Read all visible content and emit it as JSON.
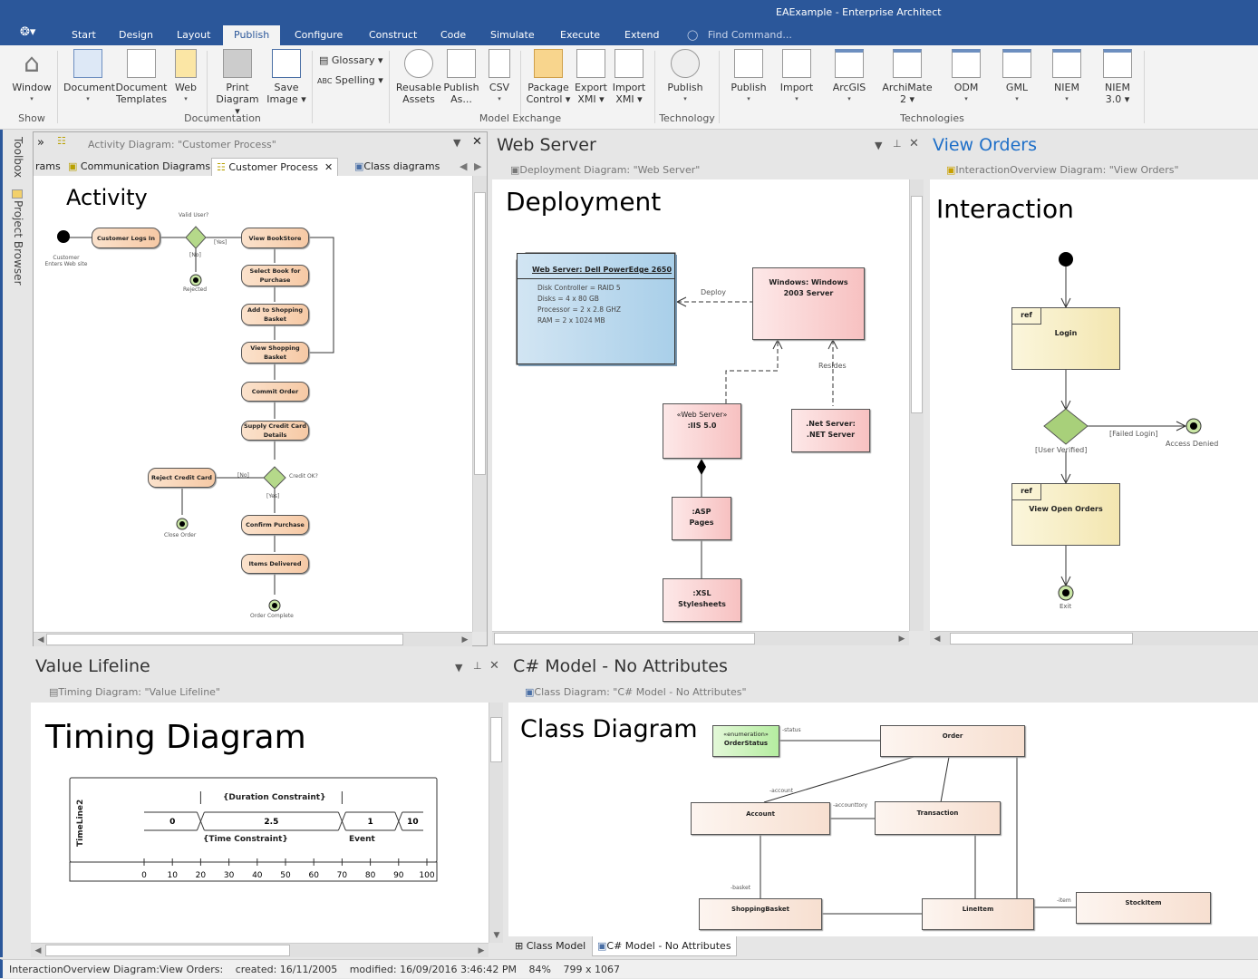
{
  "window": {
    "title": "EAExample - Enterprise Architect"
  },
  "menu": {
    "tabs": [
      "Start",
      "Design",
      "Layout",
      "Publish",
      "Configure",
      "Construct",
      "Code",
      "Simulate",
      "Execute",
      "Extend"
    ],
    "active": "Publish",
    "find_placeholder": "Find Command..."
  },
  "ribbon": {
    "buttons": [
      {
        "label": "Window",
        "sub": "▾"
      },
      {
        "label": "Document",
        "sub": "▾"
      },
      {
        "label": "Document",
        "sub": "Templates"
      },
      {
        "label": "Web",
        "sub": "▾"
      },
      {
        "label": "Print",
        "sub": "Diagram ▾"
      },
      {
        "label": "Save",
        "sub": "Image ▾"
      },
      {
        "label": "Reusable",
        "sub": "Assets"
      },
      {
        "label": "Publish",
        "sub": "As..."
      },
      {
        "label": "CSV",
        "sub": "▾"
      },
      {
        "label": "Package",
        "sub": "Control ▾"
      },
      {
        "label": "Export",
        "sub": "XMI ▾"
      },
      {
        "label": "Import",
        "sub": "XMI ▾"
      },
      {
        "label": "Publish",
        "sub": "▾"
      },
      {
        "label": "Publish",
        "sub": "▾"
      },
      {
        "label": "Import",
        "sub": "▾"
      },
      {
        "label": "ArcGIS",
        "sub": "▾"
      },
      {
        "label": "ArchiMate",
        "sub": "2 ▾"
      },
      {
        "label": "ODM",
        "sub": "▾"
      },
      {
        "label": "GML",
        "sub": "▾"
      },
      {
        "label": "NIEM",
        "sub": "▾"
      },
      {
        "label": "NIEM",
        "sub": "3.0 ▾"
      }
    ],
    "small": {
      "glossary": "Glossary ▾",
      "spelling": "Spelling ▾"
    },
    "groups": [
      "Show",
      "Documentation",
      "Model Exchange",
      "Technology",
      "Technologies"
    ]
  },
  "side": {
    "toolbox": "Toolbox",
    "project_browser": "Project Browser"
  },
  "activity_panel": {
    "header": "Activity Diagram: \"Customer Process\"",
    "tabs": [
      "rams",
      "Communication Diagrams",
      "Customer Process",
      "Class diagrams"
    ],
    "active_tab": "Customer Process",
    "heading": "Activity",
    "nodes": [
      "Customer Logs In",
      "View BookStore",
      "Select Book for Purchase",
      "Add to Shopping Basket",
      "View Shopping Basket",
      "Commit Order",
      "Supply Credit Card Details",
      "Reject Credit Card",
      "Confirm Purchase",
      "Items Delivered"
    ],
    "labels": {
      "start": "Customer Enters Web site",
      "valid": "Valid User?",
      "yes1": "[Yes]",
      "no1": "[No]",
      "rejected": "Rejected",
      "credit": "Credit OK?",
      "no2": "[No]",
      "yes2": "[Yes]",
      "close": "Close Order",
      "complete": "Order Complete"
    }
  },
  "deploy_panel": {
    "title": "Web Server",
    "header": "Deployment Diagram: \"Web Server\"",
    "heading": "Deployment",
    "node_title": "Web Server: Dell PowerEdge 2650",
    "node_props": [
      "Disk Controller = RAID 5",
      "Disks = 4 x 80 GB",
      "Processor = 2 x 2.8 GHZ",
      "RAM = 2 x 1024 MB"
    ],
    "windows": [
      "Windows: Windows",
      "2003 Server"
    ],
    "deploy": "Deploy",
    "resides": "Resides",
    "iis": [
      "«Web Server»",
      ":IIS 5.0"
    ],
    "net": [
      ".Net Server:",
      ".NET Server"
    ],
    "asp": [
      ":ASP",
      "Pages"
    ],
    "xsl": [
      ":XSL",
      "Stylesheets"
    ]
  },
  "interaction_panel": {
    "title": "View Orders",
    "header": "InteractionOverview Diagram: \"View Orders\"",
    "heading": "Interaction",
    "ref": "ref",
    "login": "Login",
    "open_orders": "View Open Orders",
    "failed": "[Failed Login]",
    "verified": "[User Verified]",
    "denied": "Access Denied",
    "exit": "Exit"
  },
  "timing_panel": {
    "title": "Value Lifeline",
    "header": "Timing Diagram: \"Value Lifeline\"",
    "heading": "Timing Diagram",
    "lifeline": "TimeLine2",
    "duration": "{Duration Constraint}",
    "time": "{Time Constraint}",
    "event": "Event",
    "states": [
      {
        "value": "0",
        "from": 0,
        "to": 20
      },
      {
        "value": "2.5",
        "from": 20,
        "to": 70
      },
      {
        "value": "1",
        "from": 70,
        "to": 90
      },
      {
        "value": "10",
        "from": 90,
        "to": 100
      }
    ],
    "ticks": [
      "0",
      "10",
      "20",
      "30",
      "40",
      "50",
      "60",
      "70",
      "80",
      "90",
      "100"
    ]
  },
  "class_panel": {
    "title": "C# Model - No Attributes",
    "header": "Class Diagram: \"C# Model - No Attributes\"",
    "heading": "Class Diagram",
    "enum_stereo": "«enumeration»",
    "classes": {
      "status": "OrderStatus",
      "order": "Order",
      "account": "Account",
      "transaction": "Transaction",
      "basket": "ShoppingBasket",
      "line": "LineItem",
      "stock": "StockItem"
    },
    "roles": {
      "status": "-status",
      "account": "-account",
      "history": "-accounttory",
      "basket": "-basket",
      "item": "-item"
    },
    "bottom_tabs": [
      "Class Model",
      "C# Model - No Attributes"
    ]
  },
  "status": {
    "diagram": "InteractionOverview Diagram:View Orders:",
    "created": "created: 16/11/2005",
    "modified": "modified: 16/09/2016 3:46:42 PM",
    "zoom": "84%",
    "size": "799 x 1067"
  }
}
